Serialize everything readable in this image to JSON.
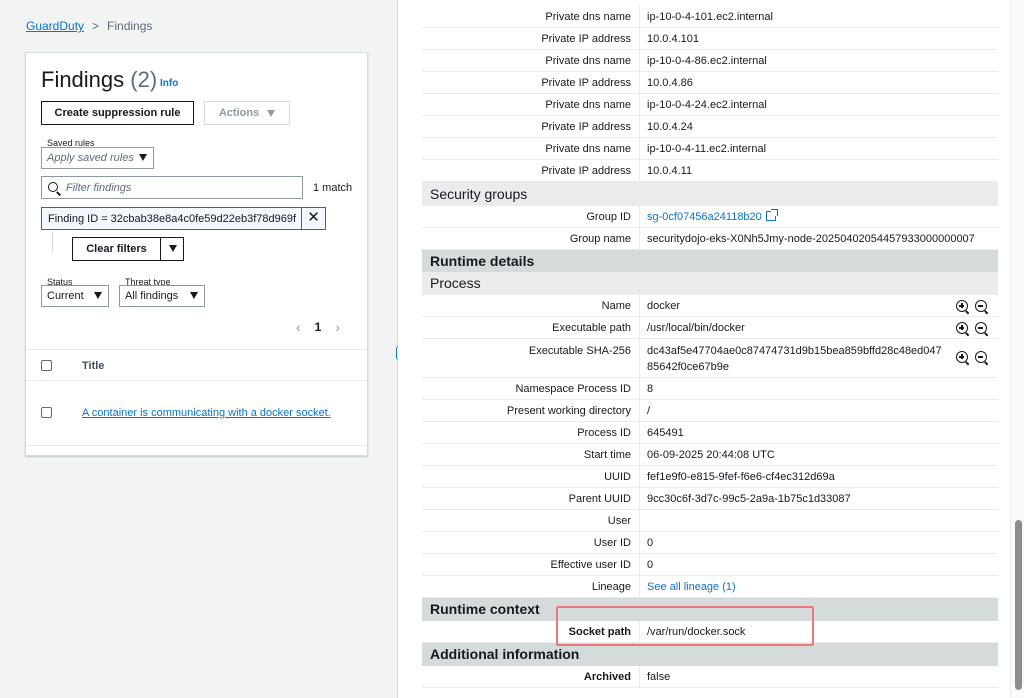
{
  "breadcrumb": {
    "root": "GuardDuty",
    "separator": ">",
    "current": "Findings"
  },
  "findings_panel": {
    "title": "Findings",
    "count": "(2)",
    "info": "Info",
    "create_button": "Create suppression rule",
    "actions_button": "Actions",
    "saved_rules_label": "Saved rules",
    "saved_rules_value": "Apply saved rules",
    "search_placeholder": "Filter findings",
    "match_text": "1 match",
    "filter_token": "Finding ID = 32cbab38e8a4c0fe59d22eb3f78d969f",
    "clear_filters": "Clear filters",
    "status_label": "Status",
    "status_value": "Current",
    "threat_label": "Threat type",
    "threat_value": "All findings",
    "page_number": "1",
    "table_header": "Title",
    "rows": [
      {
        "title": "A container is communicating with a docker socket."
      }
    ]
  },
  "details": {
    "network_rows": [
      {
        "key": "Private dns name",
        "value": "ip-10-0-4-101.ec2.internal"
      },
      {
        "key": "Private IP address",
        "value": "10.0.4.101"
      },
      {
        "key": "Private dns name",
        "value": "ip-10-0-4-86.ec2.internal"
      },
      {
        "key": "Private IP address",
        "value": "10.0.4.86"
      },
      {
        "key": "Private dns name",
        "value": "ip-10-0-4-24.ec2.internal"
      },
      {
        "key": "Private IP address",
        "value": "10.0.4.24"
      },
      {
        "key": "Private dns name",
        "value": "ip-10-0-4-11.ec2.internal"
      },
      {
        "key": "Private IP address",
        "value": "10.0.4.11"
      }
    ],
    "security_groups": {
      "heading": "Security groups",
      "group_id_key": "Group ID",
      "group_id_value": "sg-0cf07456a24118b20",
      "group_name_key": "Group name",
      "group_name_value": "securitydojo-eks-X0Nh5Jmy-node-20250402054457933000000007"
    },
    "runtime_heading": "Runtime details",
    "process_heading": "Process",
    "process": {
      "name_key": "Name",
      "name_value": "docker",
      "exec_path_key": "Executable path",
      "exec_path_value": "/usr/local/bin/docker",
      "sha_key": "Executable SHA-256",
      "sha_line1": "dc43af5e47704ae0c87474731d9b15bea859bffd28c48ed047",
      "sha_line2": "85642f0ce67b9e",
      "ns_pid_key": "Namespace Process ID",
      "ns_pid_value": "8",
      "pwd_key": "Present working directory",
      "pwd_value": "/",
      "pid_key": "Process ID",
      "pid_value": "645491",
      "start_key": "Start time",
      "start_value": "06-09-2025 20:44:08 UTC",
      "uuid_key": "UUID",
      "uuid_value": "fef1e9f0-e815-9fef-f6e6-cf4ec312d69a",
      "parent_uuid_key": "Parent UUID",
      "parent_uuid_value": "9cc30c6f-3d7c-99c5-2a9a-1b75c1d33087",
      "user_key": "User",
      "user_value": "",
      "user_id_key": "User ID",
      "user_id_value": "0",
      "eff_user_id_key": "Effective user ID",
      "eff_user_id_value": "0",
      "lineage_key": "Lineage",
      "lineage_value": "See all lineage (1)"
    },
    "runtime_context_heading": "Runtime context",
    "socket_path_key": "Socket path",
    "socket_path_value": "/var/run/docker.sock",
    "additional_heading": "Additional information",
    "archived_key": "Archived",
    "archived_value": "false"
  },
  "colors": {
    "link": "#0972d3",
    "highlight": "#e8787a",
    "section_bg": "#e9ebed"
  }
}
